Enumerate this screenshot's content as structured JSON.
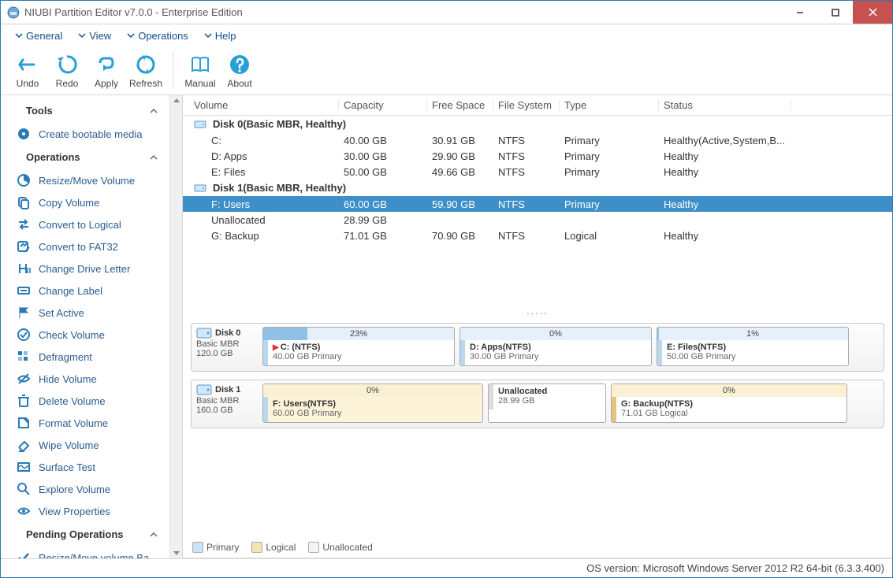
{
  "app": {
    "title": "NIUBI Partition Editor v7.0.0 - Enterprise Edition"
  },
  "menus": [
    "General",
    "View",
    "Operations",
    "Help"
  ],
  "toolbar": [
    {
      "id": "undo",
      "label": "Undo"
    },
    {
      "id": "redo",
      "label": "Redo"
    },
    {
      "id": "apply",
      "label": "Apply"
    },
    {
      "id": "refresh",
      "label": "Refresh"
    },
    {
      "id": "sep"
    },
    {
      "id": "manual",
      "label": "Manual"
    },
    {
      "id": "about",
      "label": "About"
    }
  ],
  "sidebar": {
    "sections": [
      {
        "title": "Tools",
        "items": [
          {
            "label": "Create bootable media",
            "icon": "disc"
          }
        ]
      },
      {
        "title": "Operations",
        "items": [
          {
            "label": "Resize/Move Volume",
            "icon": "pie"
          },
          {
            "label": "Copy Volume",
            "icon": "copy"
          },
          {
            "label": "Convert to Logical",
            "icon": "arrows"
          },
          {
            "label": "Convert to FAT32",
            "icon": "convert"
          },
          {
            "label": "Change Drive Letter",
            "icon": "letter"
          },
          {
            "label": "Change Label",
            "icon": "label"
          },
          {
            "label": "Set Active",
            "icon": "flag"
          },
          {
            "label": "Check Volume",
            "icon": "check"
          },
          {
            "label": "Defragment",
            "icon": "defrag"
          },
          {
            "label": "Hide Volume",
            "icon": "eye-off"
          },
          {
            "label": "Delete Volume",
            "icon": "trash"
          },
          {
            "label": "Format Volume",
            "icon": "format"
          },
          {
            "label": "Wipe Volume",
            "icon": "eraser"
          },
          {
            "label": "Surface Test",
            "icon": "surface"
          },
          {
            "label": "Explore Volume",
            "icon": "search"
          },
          {
            "label": "View Properties",
            "icon": "eye"
          }
        ]
      },
      {
        "title": "Pending Operations",
        "items": [
          {
            "label": "Resize/Move volume Ba...",
            "icon": "checkmark"
          }
        ]
      }
    ]
  },
  "columns": [
    "Volume",
    "Capacity",
    "Free Space",
    "File System",
    "Type",
    "Status"
  ],
  "disks": [
    {
      "header": "Disk 0(Basic MBR, Healthy)",
      "name": "Disk 0",
      "type_label": "Basic MBR",
      "size": "120.0 GB",
      "volumes": [
        {
          "vol": "C:",
          "cap": "40.00 GB",
          "free": "30.91 GB",
          "fs": "NTFS",
          "type": "Primary",
          "status": "Healthy(Active,System,B...",
          "usage_pct": "23%",
          "map_label": "C: (NTFS)",
          "map_sub": "40.00 GB Primary",
          "flag": true
        },
        {
          "vol": "D: Apps",
          "cap": "30.00 GB",
          "free": "29.90 GB",
          "fs": "NTFS",
          "type": "Primary",
          "status": "Healthy",
          "usage_pct": "0%",
          "map_label": "D: Apps(NTFS)",
          "map_sub": "30.00 GB Primary"
        },
        {
          "vol": "E: Files",
          "cap": "50.00 GB",
          "free": "49.66 GB",
          "fs": "NTFS",
          "type": "Primary",
          "status": "Healthy",
          "usage_pct": "1%",
          "map_label": "E: Files(NTFS)",
          "map_sub": "50.00 GB Primary"
        }
      ]
    },
    {
      "header": "Disk 1(Basic MBR, Healthy)",
      "name": "Disk 1",
      "type_label": "Basic MBR",
      "size": "160.0 GB",
      "volumes": [
        {
          "vol": "F: Users",
          "cap": "60.00 GB",
          "free": "59.90 GB",
          "fs": "NTFS",
          "type": "Primary",
          "status": "Healthy",
          "usage_pct": "0%",
          "map_label": "F: Users(NTFS)",
          "map_sub": "60.00 GB Primary",
          "selected": true
        },
        {
          "vol": "Unallocated",
          "cap": "28.99 GB",
          "free": "",
          "fs": "",
          "type": "",
          "status": "",
          "map_label": "Unallocated",
          "map_sub": "28.99 GB",
          "unalloc": true
        },
        {
          "vol": "G: Backup",
          "cap": "71.01 GB",
          "free": "70.90 GB",
          "fs": "NTFS",
          "type": "Logical",
          "status": "Healthy",
          "usage_pct": "0%",
          "map_label": "G: Backup(NTFS)",
          "map_sub": "71.01 GB Logical",
          "logical": true
        }
      ]
    }
  ],
  "legend": {
    "primary": "Primary",
    "logical": "Logical",
    "unallocated": "Unallocated"
  },
  "statusbar": "OS version: Microsoft Windows Server 2012 R2  64-bit  (6.3.3.400)"
}
